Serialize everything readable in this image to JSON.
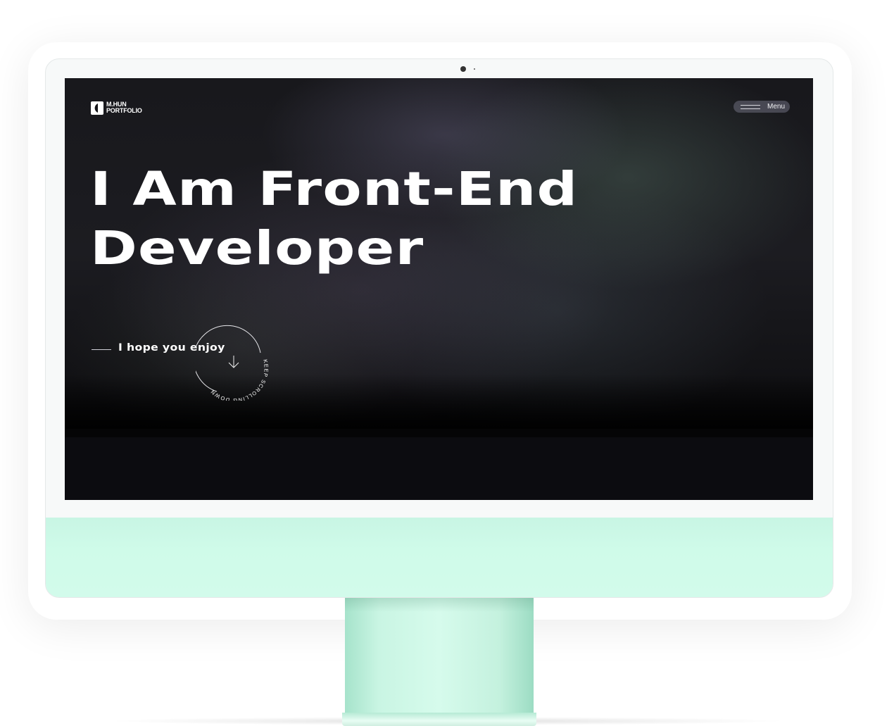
{
  "site": {
    "logo_line1": "M.HUN",
    "logo_line2": "PORTFOLIO",
    "menu_label": "Menu"
  },
  "hero": {
    "headline_line1": "I Am Front-End",
    "headline_line2": "Developer",
    "tagline": "I hope you enjoy",
    "scroll_text": "KEEP SCROLLING DOWN"
  },
  "icons": {
    "logo": "logo-mark-icon",
    "menu": "hamburger-icon",
    "scroll": "arrow-down-icon"
  },
  "colors": {
    "chin": "#cffbe9",
    "stand": "#c9f5e3",
    "screen_bg": "#0b0b0f",
    "text": "#ffffff",
    "menu_pill": "#6e6e7d"
  }
}
